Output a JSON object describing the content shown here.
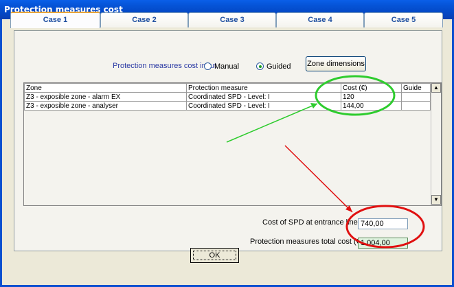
{
  "window": {
    "title": "Protection measures cost"
  },
  "tabs": [
    "Case 1",
    "Case 2",
    "Case 3",
    "Case 4",
    "Case 5"
  ],
  "input": {
    "label": "Protection measures cost input",
    "manual_label": "Manual",
    "guided_label": "Guided",
    "selected": "Guided",
    "zone_dimensions_label": "Zone dimensions"
  },
  "table": {
    "headers": [
      "Zone",
      "Protection measure",
      "Cost (€)",
      "Guide"
    ],
    "rows": [
      [
        "Z3 - exposible zone - alarm EX",
        "Coordinated SPD - Level: I",
        "120",
        ""
      ],
      [
        "Z3 - exposible zone - analyser",
        "Coordinated SPD - Level: I",
        "144,00",
        ""
      ]
    ]
  },
  "spd": {
    "label": "Cost of  SPD at entrance line",
    "value": "740,00"
  },
  "total": {
    "label": "Protection measures total cost (€)",
    "value": "1.004,00"
  },
  "buttons": {
    "ok": "OK"
  },
  "annotations": {
    "green": "#2ecc2e",
    "red": "#e01010"
  }
}
